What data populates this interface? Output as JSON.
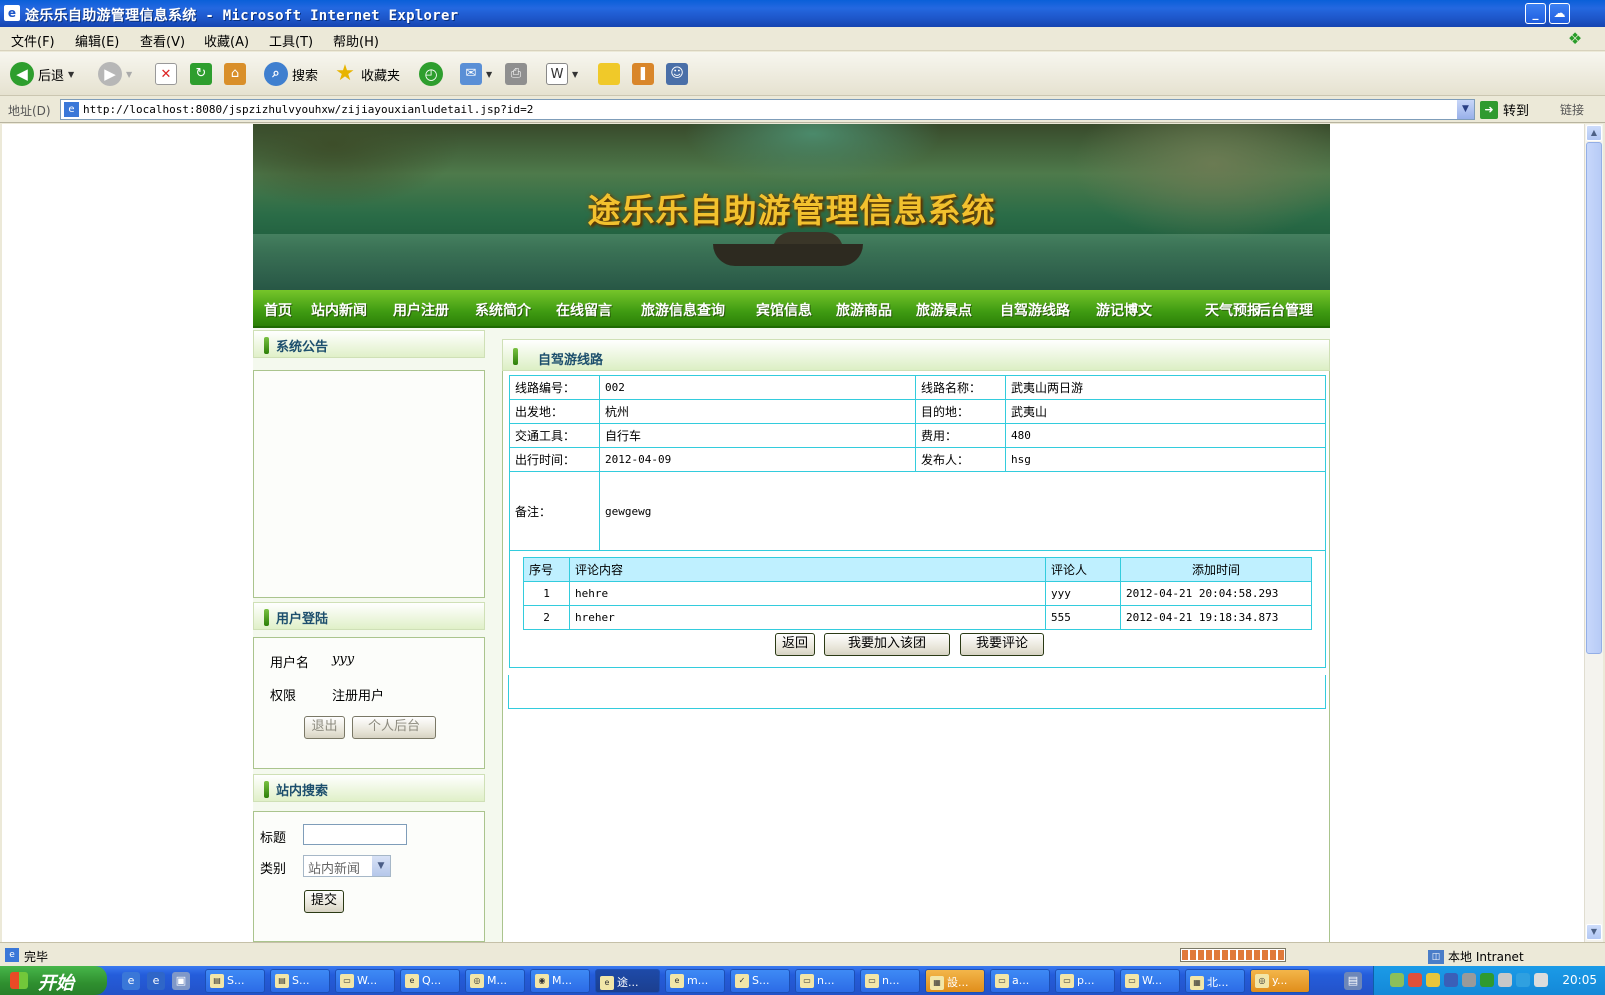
{
  "window": {
    "title": "途乐乐自助游管理信息系统 - Microsoft Internet Explorer"
  },
  "menu": [
    "文件(F)",
    "编辑(E)",
    "查看(V)",
    "收藏(A)",
    "工具(T)",
    "帮助(H)"
  ],
  "toolbar": {
    "back_label": "后退",
    "search_label": "搜索",
    "favorites_label": "收藏夹"
  },
  "address": {
    "label": "地址(D)",
    "url": "http://localhost:8080/jspzizhulvyouhxw/zijiayouxianludetail.jsp?id=2",
    "go_label": "转到",
    "links_label": "链接"
  },
  "site": {
    "title": "途乐乐自助游管理信息系统",
    "nav": [
      "首页",
      "站内新闻",
      "用户注册",
      "系统简介",
      "在线留言",
      "旅游信息查询",
      "宾馆信息",
      "旅游商品",
      "旅游景点",
      "自驾游线路",
      "游记博文",
      "天气预报",
      "后台管理"
    ]
  },
  "sidebar": {
    "notice_title": "系统公告",
    "login_title": "用户登陆",
    "username_label": "用户名",
    "username_value": "yyy",
    "role_label": "权限",
    "role_value": "注册用户",
    "logout_button": "退出",
    "personal_button": "个人后台",
    "search_title": "站内搜索",
    "search_title_label": "标题",
    "search_title_value": "",
    "category_label": "类别",
    "category_value": "站内新闻",
    "submit_button": "提交"
  },
  "main": {
    "title": "自驾游线路",
    "route_no_label": "线路编号：",
    "route_no": "002",
    "route_name_label": "线路名称：",
    "route_name": "武夷山两日游",
    "departure_label": "出发地：",
    "departure": "杭州",
    "destination_label": "目的地：",
    "destination": "武夷山",
    "transport_label": "交通工具：",
    "transport": "自行车",
    "cost_label": "费用：",
    "cost": "480",
    "date_label": "出行时间：",
    "date": "2012-04-09",
    "publisher_label": "发布人：",
    "publisher": "hsg",
    "remarks_label": "备注：",
    "remarks": "gewgewg",
    "comments": {
      "headers": [
        "序号",
        "评论内容",
        "评论人",
        "添加时间"
      ],
      "rows": [
        [
          "1",
          "hehre",
          "yyy",
          "2012-04-21 20:04:58.293"
        ],
        [
          "2",
          "hreher",
          "555",
          "2012-04-21 19:18:34.873"
        ]
      ]
    },
    "back_button": "返回",
    "join_button": "我要加入该团",
    "comment_button": "我要评论"
  },
  "status": {
    "text": "完毕",
    "zone": "本地 Intranet"
  },
  "taskbar": {
    "start_label": "开始",
    "tasks": [
      "S...",
      "S...",
      "W...",
      "Q...",
      "M...",
      "M...",
      "途...",
      "m...",
      "S...",
      "n...",
      "n...",
      "設...",
      "a...",
      "p...",
      "W...",
      "北...",
      "y..."
    ],
    "clock": "20:05"
  }
}
